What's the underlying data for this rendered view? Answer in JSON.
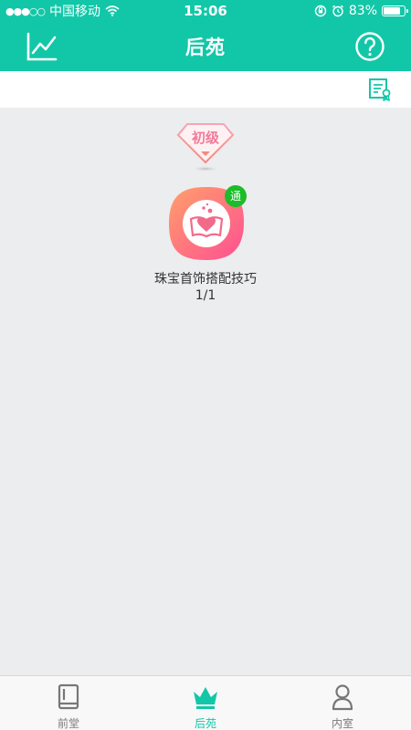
{
  "status_bar": {
    "carrier": "中国移动",
    "time": "15:06",
    "battery_percent": "83%",
    "battery_level": 0.83
  },
  "header": {
    "title": "后苑",
    "left_icon": "chart-icon",
    "right_icon": "help-icon"
  },
  "toolbar": {
    "right_icon": "certificate-icon"
  },
  "level": {
    "label": "初级"
  },
  "course": {
    "badge": "通",
    "title": "珠宝首饰搭配技巧",
    "progress": "1/1"
  },
  "tabs": [
    {
      "label": "前堂",
      "icon": "book-icon",
      "active": false
    },
    {
      "label": "后苑",
      "icon": "crown-icon",
      "active": true
    },
    {
      "label": "内室",
      "icon": "person-icon",
      "active": false
    }
  ],
  "colors": {
    "accent": "#12c7a8",
    "badge_green": "#1bbd29",
    "level_pink": "#f27b9a",
    "background": "#ecedef"
  }
}
